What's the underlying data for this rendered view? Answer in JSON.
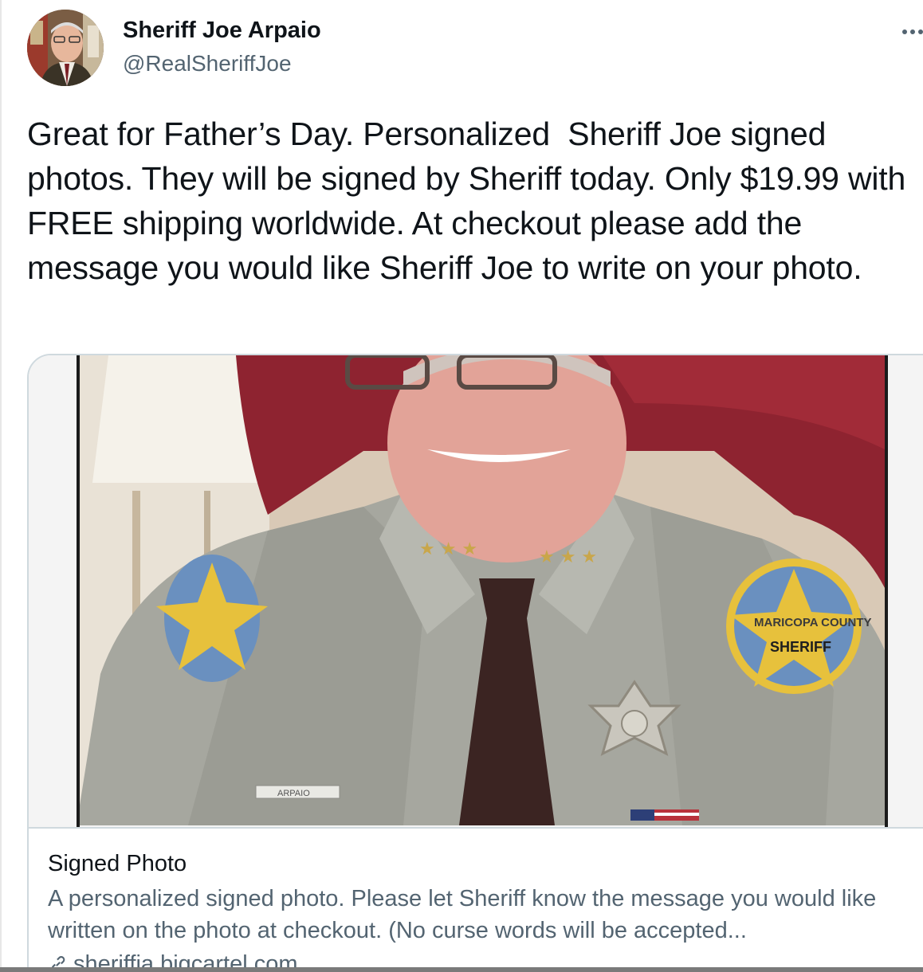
{
  "author": {
    "display_name": "Sheriff Joe Arpaio",
    "handle": "@RealSheriffJoe",
    "avatar_icon": "profile-photo"
  },
  "more_icon": "ellipsis-icon",
  "tweet": {
    "text": "Great for Father’s Day. Personalized  Sheriff Joe signed photos. They will be signed by Sheriff today. Only $19.99 with FREE shipping worldwide. At checkout please add the message you would like Sheriff Joe to write on your photo."
  },
  "card": {
    "title": "Signed Photo",
    "description": "A personalized signed photo. Please let Sheriff know the message you would like written on the photo at checkout. (No curse words will be accepted...",
    "domain": "sheriffja.bigcartel.com",
    "link_icon": "link-icon",
    "image": {
      "patch_text_1": "MARICOPA COUNTY",
      "patch_text_2": "SHERIFF",
      "nametag": "ARPAIO"
    }
  },
  "colors": {
    "text_primary": "#0f1419",
    "text_secondary": "#536471",
    "border": "#cfd9de",
    "chair": "#8e2330",
    "uniform": "#a6a79f"
  }
}
